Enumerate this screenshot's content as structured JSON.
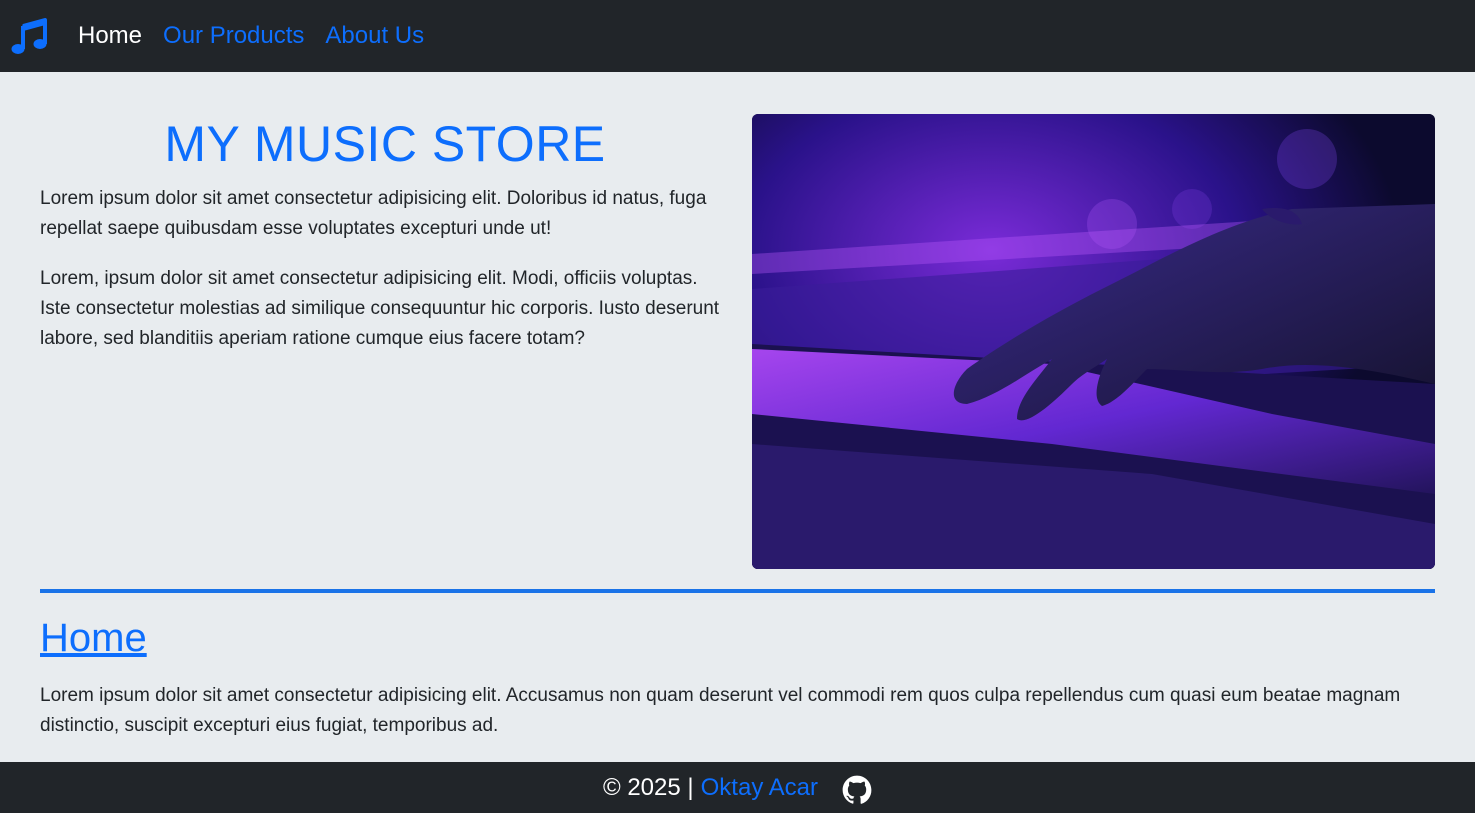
{
  "nav": {
    "logo_icon": "music-note-icon",
    "links": [
      {
        "label": "Home",
        "active": true
      },
      {
        "label": "Our Products",
        "active": false
      },
      {
        "label": "About Us",
        "active": false
      }
    ]
  },
  "hero": {
    "title": "MY MUSIC STORE",
    "paragraphs": [
      "Lorem ipsum dolor sit amet consectetur adipisicing elit. Doloribus id natus, fuga repellat saepe quibusdam esse voluptates excepturi unde ut!",
      "Lorem, ipsum dolor sit amet consectetur adipisicing elit. Modi, officiis voluptas. Iste consectetur molestias ad similique consequuntur hic corporis. Iusto deserunt labore, sed blanditiis aperiam ratione cumque eius facere totam?"
    ]
  },
  "section": {
    "heading": "Home",
    "text": "Lorem ipsum dolor sit amet consectetur adipisicing elit. Accusamus non quam deserunt vel commodi rem quos culpa repellendus cum quasi eum beatae magnam distinctio, suscipit excepturi eius fugiat, temporibus ad."
  },
  "footer": {
    "copyright": "© 2025 |",
    "author": "Oktay Acar",
    "github_icon": "github-icon"
  },
  "colors": {
    "navbar_bg": "#212529",
    "accent": "#0d6efd",
    "page_bg": "#e8ecef",
    "divider": "#1a73e8"
  }
}
